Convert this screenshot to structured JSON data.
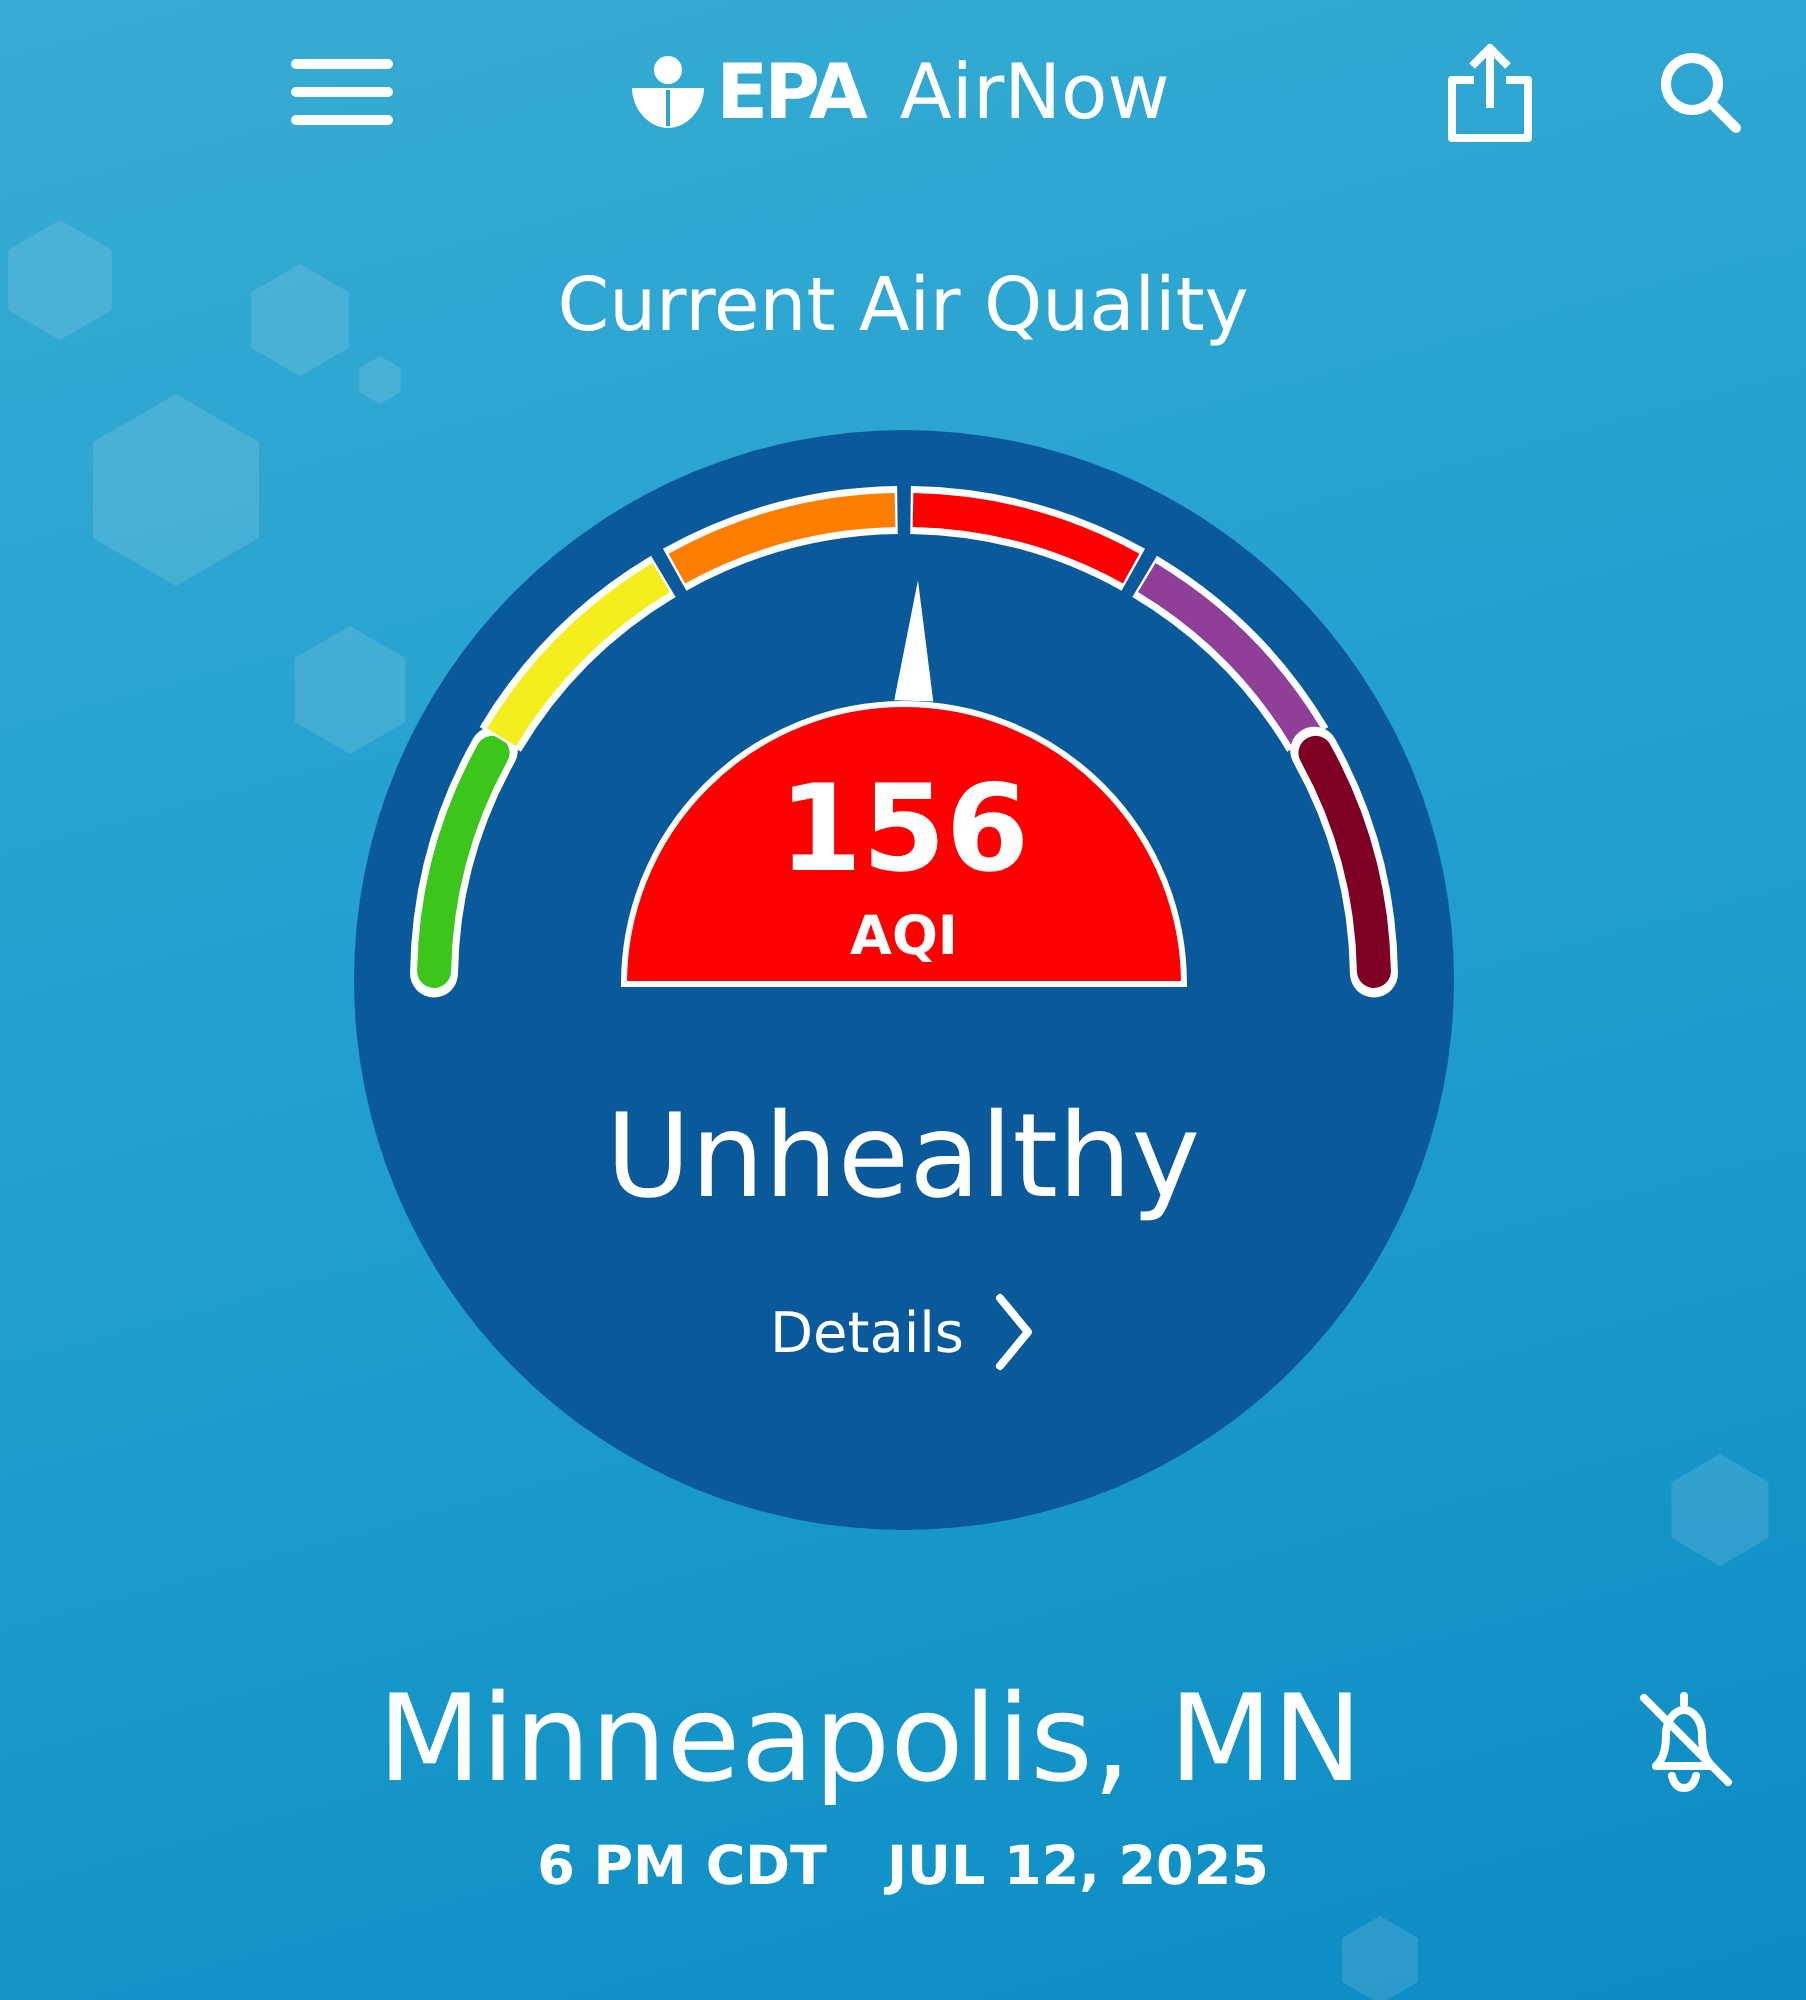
{
  "header": {
    "brand": "EPA",
    "app_name": "AirNow"
  },
  "title": "Current Air Quality",
  "gauge": {
    "aqi": "156",
    "unit": "AQI",
    "segments": [
      {
        "color": "#3cc51a"
      },
      {
        "color": "#f4ee1c"
      },
      {
        "color": "#ff7e00"
      },
      {
        "color": "#ff0000"
      },
      {
        "color": "#8f3f97"
      },
      {
        "color": "#7e0023"
      }
    ]
  },
  "category": "Unhealthy",
  "details_link": "Details",
  "location": {
    "name": "Minneapolis, MN",
    "notifications_on": false,
    "time": "6 PM CDT",
    "date": "JUL 12, 2025"
  }
}
